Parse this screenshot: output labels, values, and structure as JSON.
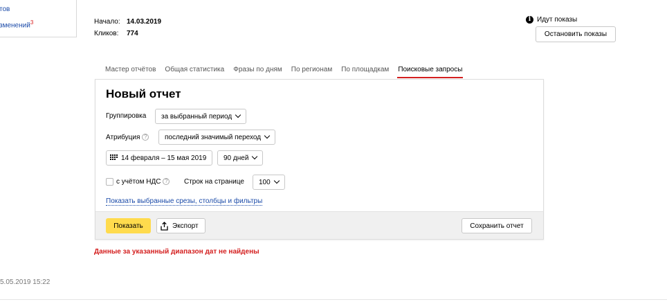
{
  "left_panel": {
    "link1": "тов",
    "link2": "зменений",
    "link2_sup": "3"
  },
  "stats": {
    "start_label": "Начало:",
    "start_value": "14.03.2019",
    "clicks_label": "Кликов:",
    "clicks_value": "774"
  },
  "status": {
    "icon": "info-icon",
    "text": "Идут показы",
    "stop_button": "Остановить показы"
  },
  "tabs": [
    {
      "label": "Мастер отчётов",
      "active": false
    },
    {
      "label": "Общая статистика",
      "active": false
    },
    {
      "label": "Фразы по дням",
      "active": false
    },
    {
      "label": "По регионам",
      "active": false
    },
    {
      "label": "По площадкам",
      "active": false
    },
    {
      "label": "Поисковые запросы",
      "active": true
    }
  ],
  "report": {
    "title": "Новый отчет",
    "grouping_label": "Группировка",
    "grouping_value": "за выбранный период",
    "attribution_label": "Атрибуция",
    "attribution_value": "последний значимый переход",
    "date_range": "14 февраля – 15 мая 2019",
    "period_value": "90 дней",
    "vat_label": "с учётом НДС",
    "vat_checked": false,
    "rows_label": "Строк на странице",
    "rows_value": "100",
    "show_slices_link": "Показать выбранные срезы, столбцы и фильтры",
    "show_button": "Показать",
    "export_button": "Экспорт",
    "save_button": "Сохранить отчет"
  },
  "error_message": "Данные за указанный диапазон дат не найдены",
  "timestamp": "5.05.2019 15:22",
  "colors": {
    "accent_yellow": "#ffdb4d",
    "error_red": "#d42020",
    "link_blue": "#1a4aa8"
  }
}
